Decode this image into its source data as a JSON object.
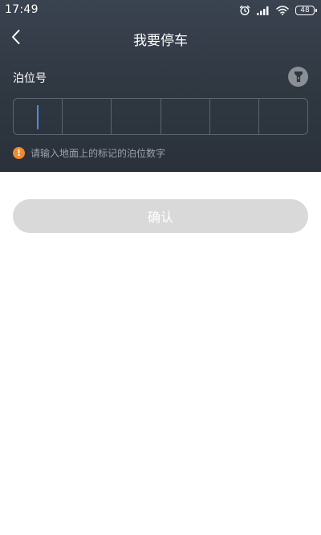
{
  "status_bar": {
    "time": "17:49",
    "icons": [
      "alarm-icon",
      "signal-icon",
      "wifi-icon",
      "battery-icon"
    ],
    "battery_level": "48"
  },
  "header": {
    "back_icon": "chevron-left-icon",
    "title": "我要停车"
  },
  "form": {
    "label": "泊位号",
    "flashlight_icon": "flashlight-icon",
    "code_cells": [
      "",
      "",
      "",
      "",
      "",
      ""
    ],
    "active_cell": 0,
    "hint_icon": "exclamation-icon",
    "hint": "请输入地面上的标记的泊位数字"
  },
  "actions": {
    "confirm_label": "确认"
  },
  "colors": {
    "header_bg": "#2f3741",
    "caret": "#4d8af0",
    "hint_icon": "#ef8a2e",
    "button_disabled": "#d9d9d9"
  }
}
